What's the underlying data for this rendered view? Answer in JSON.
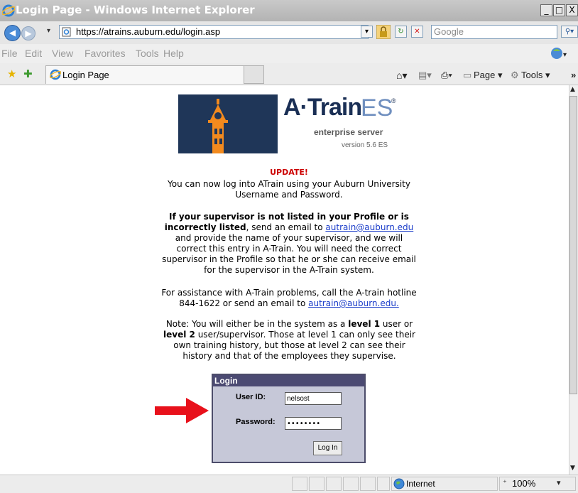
{
  "window": {
    "title": "Login Page - Windows Internet Explorer",
    "minimize_label": "_",
    "maximize_label": "□",
    "close_label": "X"
  },
  "address_bar": {
    "url": "https://atrains.auburn.edu/login.asp",
    "search_placeholder": "Google"
  },
  "menu": [
    "File",
    "Edit",
    "View",
    "Favorites",
    "Tools",
    "Help"
  ],
  "tab": {
    "label": "Login Page",
    "commands": [
      "Page ▾",
      "Tools ▾"
    ]
  },
  "logo": {
    "brand_a": "A·Train",
    "brand_es": "ES",
    "registered": "®",
    "subtitle": "enterprise server",
    "version": "version 5.6 ES"
  },
  "content": {
    "update_heading": "UPDATE!",
    "update_text": "You can now log into ATrain using your Auburn University Username and Password.",
    "supervisor_bold": "If your supervisor is not listed in your Profile or is incorrectly listed",
    "supervisor_text_1": ", send an email to ",
    "supervisor_email": "autrain@auburn.edu",
    "supervisor_text_2": " and provide the name of your supervisor, and we will correct this entry in A-Train.  You will need the correct supervisor in the Profile so that he or she can receive email for the supervisor in the A-Train system.",
    "assistance_text": "For assistance with A-Train problems, call the A-train hotline 844-1622 or send an email to ",
    "assistance_email": "autrain@auburn.edu.",
    "note_1": "Note:  You will either be in the system as a ",
    "note_level1": "level 1",
    "note_2": " user or ",
    "note_level2": "level 2",
    "note_3": " user/supervisor.  Those at level 1 can only see their own training history, but those at level 2 can see their history and that of the employees they supervise."
  },
  "login": {
    "title": "Login",
    "user_id_label": "User ID:",
    "user_id_value": "nelsost",
    "password_label": "Password:",
    "password_value": "••••••••",
    "submit_label": "Log In"
  },
  "status_bar": {
    "zone": "Internet",
    "zoom": "100%"
  },
  "colors": {
    "annotation_arrow": "#e8111b",
    "update_heading": "#cc0000",
    "link": "#1a3cc9",
    "login_header": "#4b4a72"
  }
}
